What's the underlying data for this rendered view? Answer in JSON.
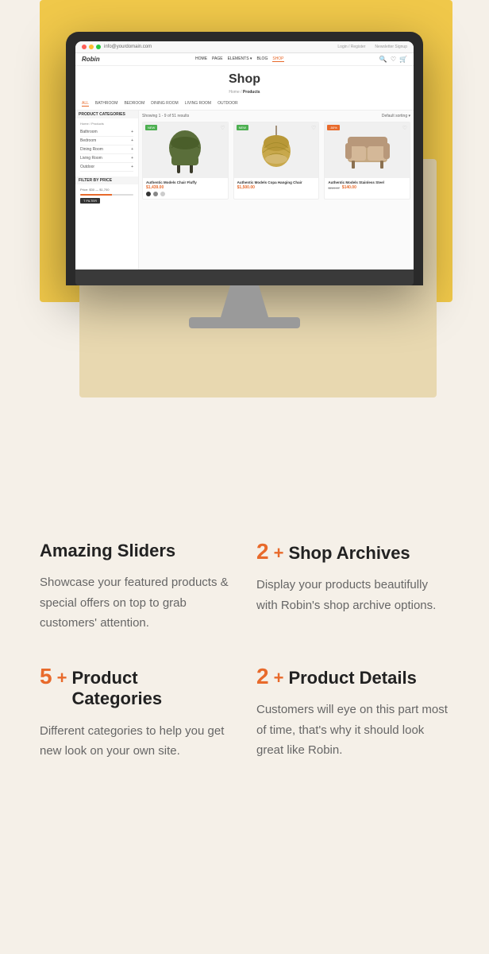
{
  "page": {
    "bg_color": "#f5f0e8"
  },
  "monitor": {
    "browser": {
      "topbar_url": "info@yourdomain.com",
      "nav_items": [
        "HOME",
        "PAGE",
        "ELEMENTS",
        "BLOG",
        "SHOP"
      ],
      "active_nav": "SHOP",
      "login": "Login / Register",
      "newsletter": "Newsletter Signup"
    },
    "shop": {
      "title": "Shop",
      "breadcrumb_home": "Home",
      "breadcrumb_current": "Products",
      "filter_tabs": [
        "ALL",
        "BATHROOM",
        "BEDROOM",
        "DINING ROOM",
        "LIVING ROOM",
        "OUTDOOR"
      ],
      "results_text": "Showing 1 - 9 of 51 results",
      "sort_default": "Default sorting",
      "sidebar": {
        "categories_title": "PRODUCT CATEGORIES",
        "categories": [
          "Bathroom",
          "Bedroom",
          "Dining Room",
          "Living Room",
          "Outdoor"
        ],
        "filter_price_title": "FILTER BY PRICE",
        "price_range": "Price: $30 — $1,700",
        "filter_button": "T FILTER"
      },
      "products": [
        {
          "name": "Authentic Models Chair Fluffy",
          "price": "$1,439.00",
          "badge": "NEW",
          "badge_type": "new",
          "color": "#5a6e3a"
        },
        {
          "name": "Authentic Models Copa Hanging Chair",
          "price": "$1,500.00",
          "badge": "NEW",
          "badge_type": "new",
          "color": "#c8a84b"
        },
        {
          "name": "Authentic Models Stainless Steel",
          "price": "$140.00",
          "price_old": "$269.67",
          "badge": "-50%",
          "badge_type": "sale",
          "color": "#c4a882"
        }
      ]
    }
  },
  "features": [
    {
      "id": "amazing-sliders",
      "has_count": false,
      "title": "Amazing Sliders",
      "description": "Showcase your featured products & special offers on top to grab customers' attention."
    },
    {
      "id": "shop-archives",
      "has_count": true,
      "count": "2",
      "plus": "+",
      "title": "Shop Archives",
      "description": "Display your products beautifully with Robin's shop archive options."
    },
    {
      "id": "product-categories",
      "has_count": true,
      "count": "5",
      "plus": "+",
      "title": "Product Categories",
      "description": "Different categories to help you get new look on your own site."
    },
    {
      "id": "product-details",
      "has_count": true,
      "count": "2",
      "plus": "+",
      "title": "Product Details",
      "description": "Customers will eye on this part most of time, that's why it should look great like Robin."
    }
  ]
}
